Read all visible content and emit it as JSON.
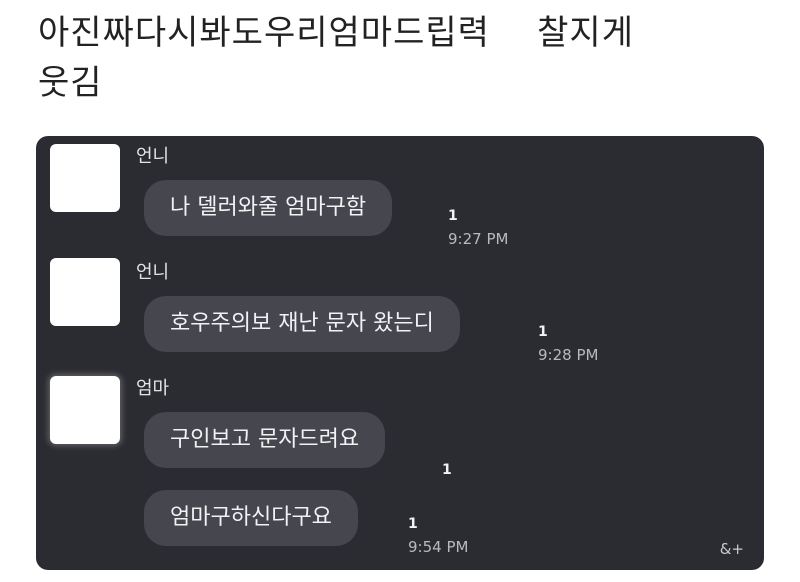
{
  "post": {
    "title": "아진짜다시봐도우리엄마드립력    찰지게\n웃김"
  },
  "chat": {
    "messages": [
      {
        "sender": "언니",
        "text": "나 델러와줄 엄마구함",
        "unread": "1",
        "time": "9:27 PM"
      },
      {
        "sender": "언니",
        "text": "호우주의보 재난 문자 왔는디",
        "unread": "1",
        "time": "9:28 PM"
      },
      {
        "sender": "엄마",
        "text": "구인보고 문자드려요",
        "unread": "1",
        "time": ""
      },
      {
        "sender": "",
        "text": "엄마구하신다구요",
        "unread": "1",
        "time": "9:54 PM"
      }
    ],
    "footer_icon_text": "&+"
  },
  "colors": {
    "chat_background": "#2b2c32",
    "bubble_background": "#45464e",
    "text_light": "#f2f2f4",
    "time_text": "#b9bac0"
  }
}
